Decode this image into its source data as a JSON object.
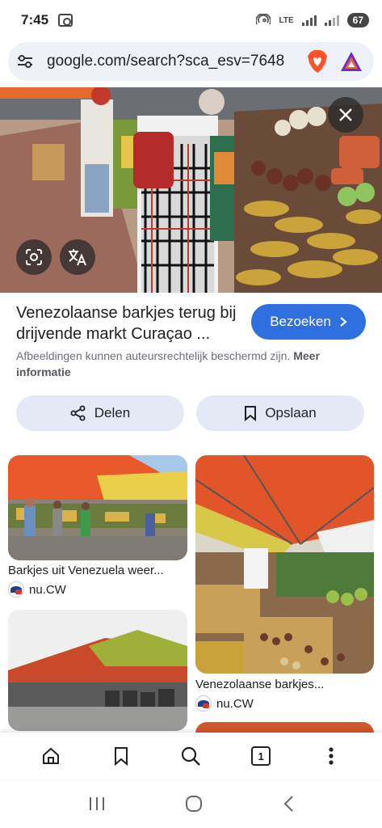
{
  "status_bar": {
    "time": "7:45",
    "network": "LTE",
    "battery": "67"
  },
  "browser": {
    "url": "google.com/search?sca_esv=7648",
    "icons": [
      "tune-icon",
      "brave-lion-icon",
      "brave-rewards-icon"
    ]
  },
  "result": {
    "title": "Venezolaanse barkjes terug bij drijvende markt Curaçao ...",
    "visit_label": "Bezoeken",
    "copyright_text": "Afbeeldingen kunnen auteursrechtelijk beschermd zijn.",
    "more_info_label": "Meer informatie",
    "share_label": "Delen",
    "save_label": "Opslaan"
  },
  "related": [
    {
      "caption": "Barkjes uit Venezuela weer...",
      "source": "nu.CW"
    },
    {
      "caption": "Venezolaanse barkjes...",
      "source": "nu.CW"
    }
  ],
  "bottom_nav": {
    "tab_count": "1",
    "icons": [
      "home-icon",
      "bookmark-icon",
      "search-icon",
      "tabs-icon",
      "more-icon"
    ]
  },
  "colors": {
    "accent": "#2f6fe0",
    "pill_bg": "#e3eaf6",
    "url_bg": "#eef1f7",
    "brave": "#fb542b"
  }
}
